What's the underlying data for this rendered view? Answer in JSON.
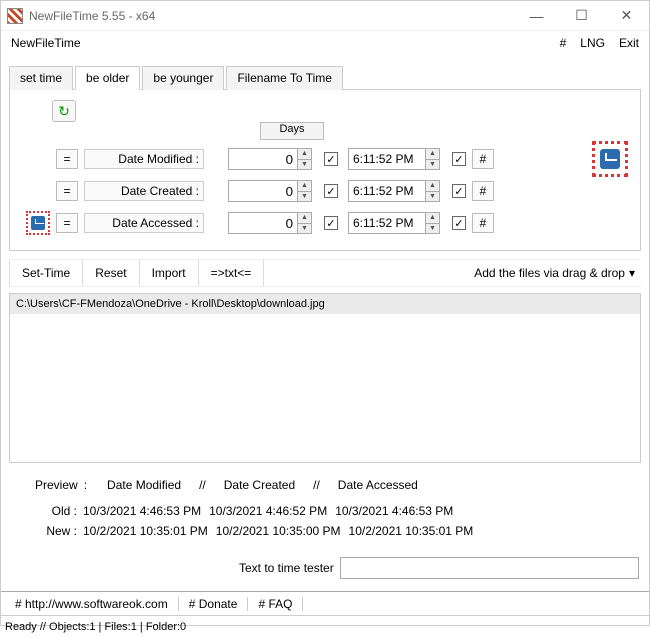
{
  "window": {
    "title": "NewFileTime 5.55 - x64"
  },
  "menubar": {
    "app_name": "NewFileTime",
    "hash": "#",
    "lng": "LNG",
    "exit": "Exit"
  },
  "tabs": {
    "set_time": "set time",
    "be_older": "be older",
    "be_younger": "be younger",
    "filename_to_time": "Filename To Time"
  },
  "days_header": "Days",
  "rows": {
    "modified": {
      "eq": "=",
      "label": "Date Modified :",
      "num": "0",
      "time": "6:11:52 PM"
    },
    "created": {
      "eq": "=",
      "label": "Date Created :",
      "num": "0",
      "time": "6:11:52 PM"
    },
    "accessed": {
      "eq": "=",
      "label": "Date Accessed :",
      "num": "0",
      "time": "6:11:52 PM"
    }
  },
  "toolbar": {
    "set_time": "Set-Time",
    "reset": "Reset",
    "import": "Import",
    "txt": "=>txt<=",
    "drag_label": "Add the files via drag & drop"
  },
  "files": [
    "C:\\Users\\CF-FMendoza\\OneDrive - Kroll\\Desktop\\download.jpg"
  ],
  "preview": {
    "header": {
      "preview": "Preview",
      "modified": "Date Modified",
      "created": "Date Created",
      "accessed": "Date Accessed",
      "sep": "//",
      "colon": ":"
    },
    "old_label": "Old :",
    "new_label": "New :",
    "old": {
      "modified": "10/3/2021 4:46:53 PM",
      "created": "10/3/2021 4:46:52 PM",
      "accessed": "10/3/2021 4:46:53 PM"
    },
    "new": {
      "modified": "10/2/2021 10:35:01 PM",
      "created": "10/2/2021 10:35:00 PM",
      "accessed": "10/2/2021 10:35:01 PM"
    }
  },
  "text_tester_label": "Text to time tester",
  "footer": {
    "site": "# http://www.softwareok.com",
    "donate": "# Donate",
    "faq": "# FAQ"
  },
  "status": "Ready // Objects:1 | Files:1 | Folder:0",
  "glyphs": {
    "check": "☑",
    "up": "▲",
    "down": "▼",
    "dropdown": "▾",
    "hash": "#",
    "min": "—",
    "max": "☐",
    "close": "✕",
    "eq": "="
  }
}
